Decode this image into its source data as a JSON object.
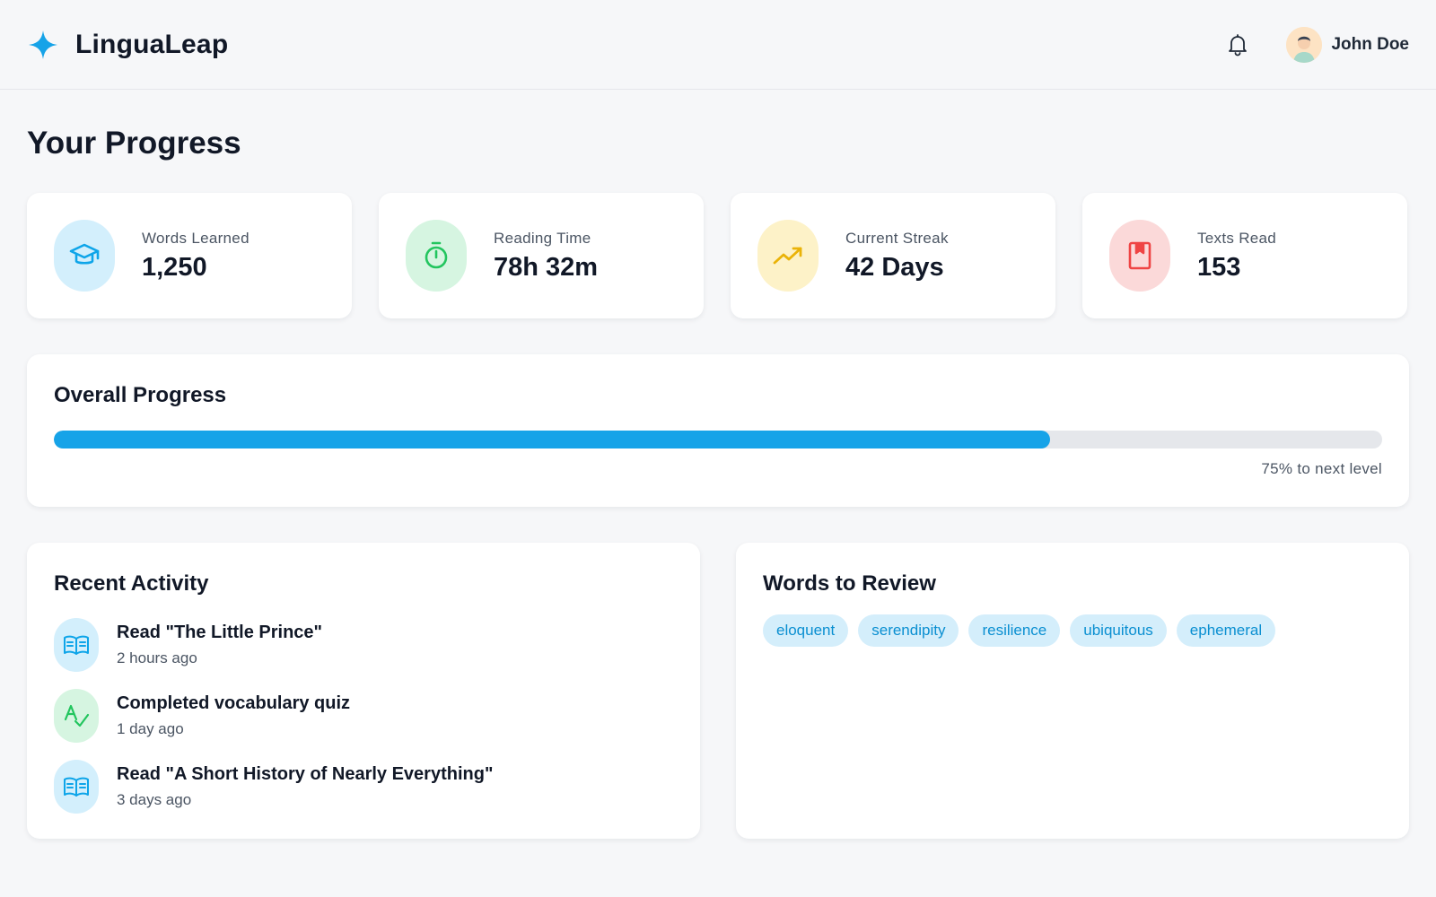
{
  "app": {
    "name": "LinguaLeap",
    "accent": "#16a3e8"
  },
  "header": {
    "user_name": "John Doe"
  },
  "page": {
    "title": "Your Progress"
  },
  "stats": [
    {
      "label": "Words Learned",
      "value": "1,250",
      "icon": "graduation-cap-icon",
      "icon_color": "#0ea5e9",
      "bg": "#d3effc"
    },
    {
      "label": "Reading Time",
      "value": "78h 32m",
      "icon": "stopwatch-icon",
      "icon_color": "#22c55e",
      "bg": "#d6f5e1"
    },
    {
      "label": "Current Streak",
      "value": "42 Days",
      "icon": "trending-up-icon",
      "icon_color": "#eab308",
      "bg": "#fdf2c8"
    },
    {
      "label": "Texts Read",
      "value": "153",
      "icon": "bookmark-book-icon",
      "icon_color": "#ef4444",
      "bg": "#fbd9d9"
    }
  ],
  "progress": {
    "title": "Overall Progress",
    "percent": 75,
    "caption": "75% to next level"
  },
  "activity": {
    "title": "Recent Activity",
    "items": [
      {
        "title": "Read \"The Little Prince\"",
        "time": "2 hours ago",
        "icon": "open-book-icon"
      },
      {
        "title": "Completed vocabulary quiz",
        "time": "1 day ago",
        "icon": "spell-check-icon"
      },
      {
        "title": "Read \"A Short History of Nearly Everything\"",
        "time": "3 days ago",
        "icon": "open-book-icon"
      }
    ]
  },
  "review": {
    "title": "Words to Review",
    "words": [
      "eloquent",
      "serendipity",
      "resilience",
      "ubiquitous",
      "ephemeral"
    ]
  }
}
